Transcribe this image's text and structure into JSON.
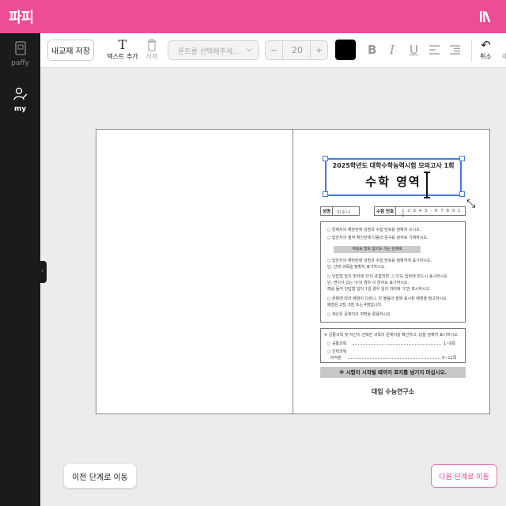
{
  "app": {
    "logo": "파피"
  },
  "sidebar": {
    "items": [
      {
        "label": "paffy",
        "icon": "document-icon"
      },
      {
        "label": "my",
        "icon": "user-edit-icon"
      }
    ]
  },
  "toolbar": {
    "save_label": "내교재 저장",
    "add_text_label": "텍스트 추가",
    "delete_label": "삭제",
    "font_placeholder": "폰트를 선택해주세...",
    "font_size": "20",
    "minus": "−",
    "plus": "+",
    "text_color": "#000000",
    "bold": "B",
    "italic": "I",
    "underline": "U",
    "undo_label": "취소",
    "redo_label": "재"
  },
  "document": {
    "title_line1": "2025학년도 대학수학능력시험 모의고사 1회",
    "title_line2": "수학 영역",
    "name_label": "성명",
    "name_value": "이두나",
    "exam_no_label": "수험 번호",
    "exam_no_value": "1 2 3 4 5 - 6 7 8 9 1 0",
    "notices": [
      "○ 문제지의 해당란에 성명과 수험 번호를 정확히 쓰시오.",
      "○ 답안지의 필적 확인란에 다음의 문구를 정자로 기재하시오.",
      "○ 답안지의 해당란에 성명과 수험 번호를 정확하게 표기하시오.",
      "   단, 선택 과목을 정확히 표기하시오.",
      "○ 단답형 답의 숫자에 '0'이 포함되면 그 '0'도 답란에 반드시 표시하시오.",
      "   단, 변이가 있는 '0'의 경우 이 문자도 표기하시오.",
      "   예를 들어 단답형 답이 1일 경우 일의 자리에 '1'만 표시하시오.",
      "○ 문항에 따라 배점이 다르니, 각 물음의 끝에 표시된 배점을 참고하시오.",
      "   배점은 2점, 3점 또는 4점입니다.",
      "○ 계산은 문제지의 여백을 활용하시오."
    ],
    "notice_bar": "여름을 꿈꿔 참아도 하는 준제로",
    "subject_header": "※ 공통과목 및 자신이 선택한 과목의 문제지를 확인하고, 답을 정확히 표시하시오.",
    "subject_common": "○ 공통과목",
    "subject_common_range": "1~8쪽",
    "subject_select": "○ 선택과목",
    "subject_select_name": "미적분",
    "subject_select_range": "9~12쪽",
    "bottom_notice": "※ 시험이 시작될 때까지 표지를 넘기지 마십시오.",
    "institute": "대입 수능연구소"
  },
  "footer": {
    "prev_label": "이전 단계로 이동",
    "next_label": "다음 단계로 이동"
  },
  "colors": {
    "brand": "#ec4d95",
    "sidebar": "#1b1b1b",
    "selection": "#3d7fe0"
  }
}
